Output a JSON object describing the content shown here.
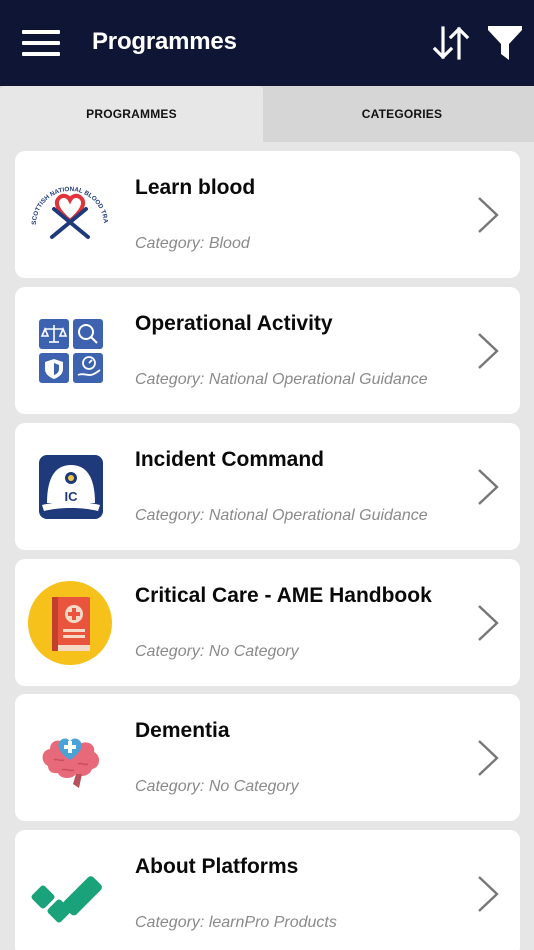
{
  "header": {
    "title": "Programmes",
    "icons": {
      "menu": "hamburger-menu-icon",
      "sort": "sort-arrows-icon",
      "filter": "filter-funnel-icon"
    }
  },
  "tabs": [
    {
      "label": "PROGRAMMES",
      "active": true
    },
    {
      "label": "CATEGORIES",
      "active": false
    }
  ],
  "programmes": [
    {
      "name": "Learn blood",
      "category": "Category: Blood",
      "logo": "blood-transfusion-logo",
      "logo_text": "SCOTTISH NATIONAL BLOOD TRANSFUSION SERVICE"
    },
    {
      "name": "Operational Activity",
      "category": "Category: National Operational Guidance",
      "logo": "operational-activity-icon"
    },
    {
      "name": "Incident Command",
      "category": "Category: National Operational Guidance",
      "logo": "incident-command-helmet-icon",
      "logo_text": "IC"
    },
    {
      "name": "Critical Care - AME Handbook",
      "category": "Category: No Category",
      "logo": "medical-handbook-icon"
    },
    {
      "name": "Dementia",
      "category": "Category: No Category",
      "logo": "dementia-brain-heart-icon"
    },
    {
      "name": "About Platforms",
      "category": "Category: learnPro Products",
      "logo": "learnpro-logo"
    }
  ],
  "colors": {
    "header_bg": "#0f1635",
    "tab_bar_bg": "#d6d6d6",
    "active_tab_bg": "#e7e7e7",
    "card_bg": "#ffffff",
    "category_text": "#8a8a8a",
    "blood_red": "#e0343a",
    "navy": "#1f3a7a",
    "ops_blue": "#3d62b0",
    "handbook_yellow": "#f7c11b",
    "handbook_red": "#e8553c",
    "learnpro_green": "#1aa27a"
  }
}
